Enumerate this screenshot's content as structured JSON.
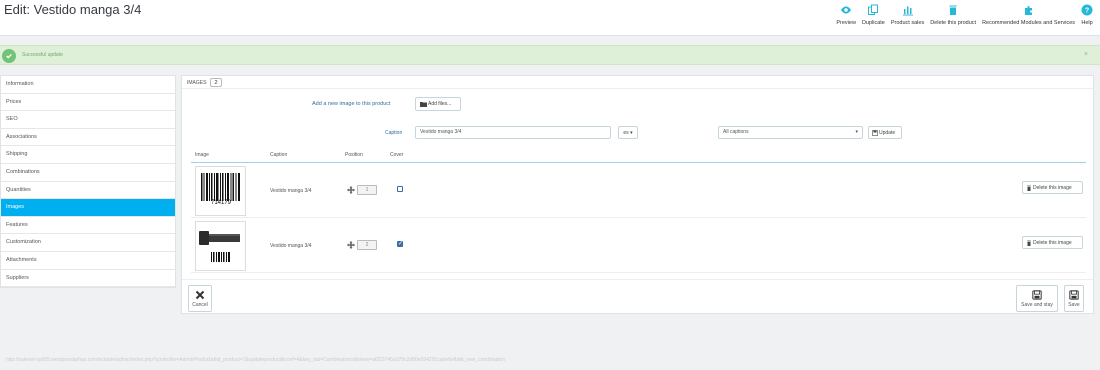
{
  "header": {
    "title": "Edit: Vestido manga 3/4",
    "toolbar": [
      {
        "label": "Preview",
        "icon": "eye-icon"
      },
      {
        "label": "Duplicate",
        "icon": "copy-icon"
      },
      {
        "label": "Product sales",
        "icon": "bar-chart-icon"
      },
      {
        "label": "Delete this product",
        "icon": "trash-icon"
      },
      {
        "label": "Recommended Modules and Services",
        "icon": "puzzle-icon"
      },
      {
        "label": "Help",
        "icon": "help-icon"
      }
    ]
  },
  "alert": {
    "text": "Successful update",
    "close": "×"
  },
  "sidebar": {
    "items": [
      {
        "label": "Information"
      },
      {
        "label": "Prices"
      },
      {
        "label": "SEO"
      },
      {
        "label": "Associations"
      },
      {
        "label": "Shipping"
      },
      {
        "label": "Combinations"
      },
      {
        "label": "Quantities"
      },
      {
        "label": "Images"
      },
      {
        "label": "Features"
      },
      {
        "label": "Customization"
      },
      {
        "label": "Attachments"
      },
      {
        "label": "Suppliers"
      }
    ],
    "active_index": 7
  },
  "panel": {
    "title": "IMAGES",
    "count": "2",
    "add_label": "Add a new image to this product",
    "add_files": "Add files...",
    "caption_label": "Caption",
    "caption_value": "Vestido manga 3/4",
    "lang": "es ▾",
    "all_captions": "All captions",
    "update": "Update",
    "columns": {
      "image": "Image",
      "caption": "Caption",
      "position": "Position",
      "cover": "Cover"
    },
    "rows": [
      {
        "caption": "Vestido manga 3/4",
        "position": "1",
        "cover": false,
        "delete": "Delete this image",
        "thumb_text": "714179"
      },
      {
        "caption": "Vestido manga 3/4",
        "position": "2",
        "cover": true,
        "delete": "Delete this image",
        "thumb_text": ""
      }
    ],
    "cancel": "Cancel",
    "save_and_stay": "Save and stay",
    "save": "Save"
  },
  "status_url": "http://salenef-sp005.westprestashop.com/ectadm/admin/index.php?controller=AdminProducts&id_product=1&updateproduct&conf=4&key_tab=Combinations&token=af323745a079c2d60e594291cabe6efbdd_new_combination",
  "colors": {
    "accent": "#00aff0",
    "success_bg": "#dff0d8",
    "success_icon": "#72c279",
    "toolbar_icon": "#25b9d7"
  }
}
